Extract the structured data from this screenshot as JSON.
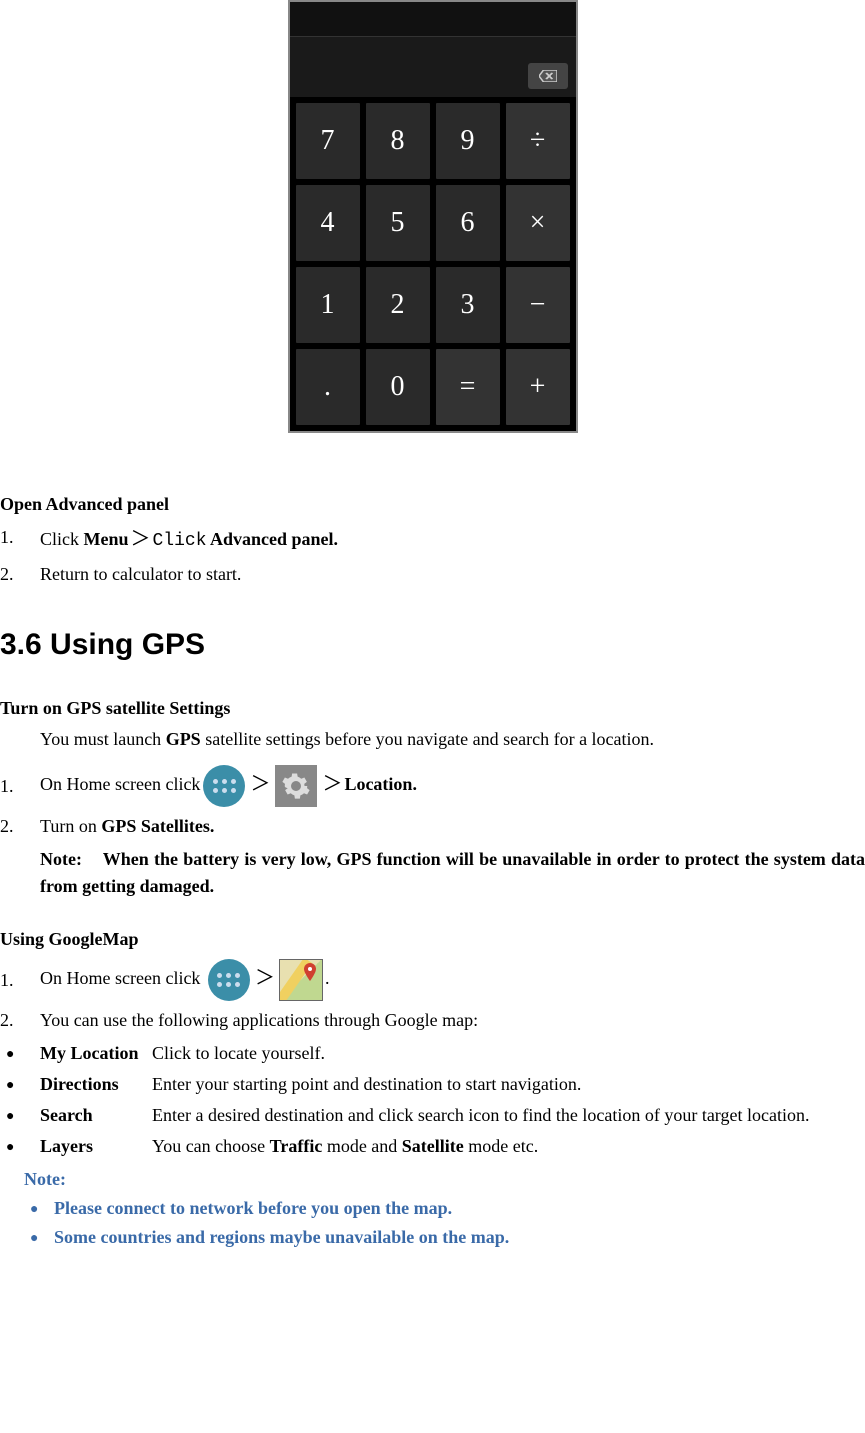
{
  "calculator": {
    "keys": [
      [
        "7",
        "8",
        "9",
        "÷"
      ],
      [
        "4",
        "5",
        "6",
        "×"
      ],
      [
        "1",
        "2",
        "3",
        "−"
      ],
      [
        ".",
        "0",
        "=",
        "+"
      ]
    ]
  },
  "section_open_advanced": {
    "title": "Open Advanced panel",
    "step1_num": "1.",
    "step1_a": "Click ",
    "step1_b": "Menu",
    "step1_c": "＞",
    "step1_d": "Click",
    "step1_e": " Advanced panel.",
    "step2_num": "2.",
    "step2": "Return to calculator to start."
  },
  "heading_gps": "3.6 Using GPS",
  "turn_on": {
    "title": "Turn on GPS satellite Settings",
    "intro_a": "You must launch ",
    "intro_b": "GPS",
    "intro_c": " satellite settings before you navigate and search for a location.",
    "step1_num": "1.",
    "step1_a": "On Home screen click",
    "step1_gt1": "＞",
    "step1_gt2": "＞",
    "step1_b": "Location.",
    "step2_num": "2.",
    "step2_a": "Turn on ",
    "step2_b": "GPS Satellites.",
    "note_label": "Note:",
    "note_text": "When the battery is very low, GPS function will be unavailable in order to protect the system data from getting damaged."
  },
  "googlemap": {
    "title": "Using GoogleMap",
    "step1_num": "1.",
    "step1_a": "On Home screen click ",
    "step1_gt": "＞",
    "step1_end": ".",
    "step2_num": "2.",
    "step2": "You can use the following applications through Google map:",
    "apps": {
      "my_location": {
        "name": "My Location",
        "desc": "Click to locate yourself."
      },
      "directions": {
        "name": "Directions",
        "desc": "Enter your starting point and destination to start navigation."
      },
      "search": {
        "name": "Search",
        "desc": "Enter a desired destination and click search icon to find the location of your target location."
      },
      "layers": {
        "name": "Layers",
        "desc_a": "You can choose ",
        "desc_b": "Traffic",
        "desc_c": " mode and ",
        "desc_d": "Satellite",
        "desc_e": " mode etc."
      }
    },
    "note_label": "Note:",
    "note1": "Please connect to network before you open the map.",
    "note2": "Some countries and regions maybe unavailable on the map."
  },
  "bullet": "●"
}
